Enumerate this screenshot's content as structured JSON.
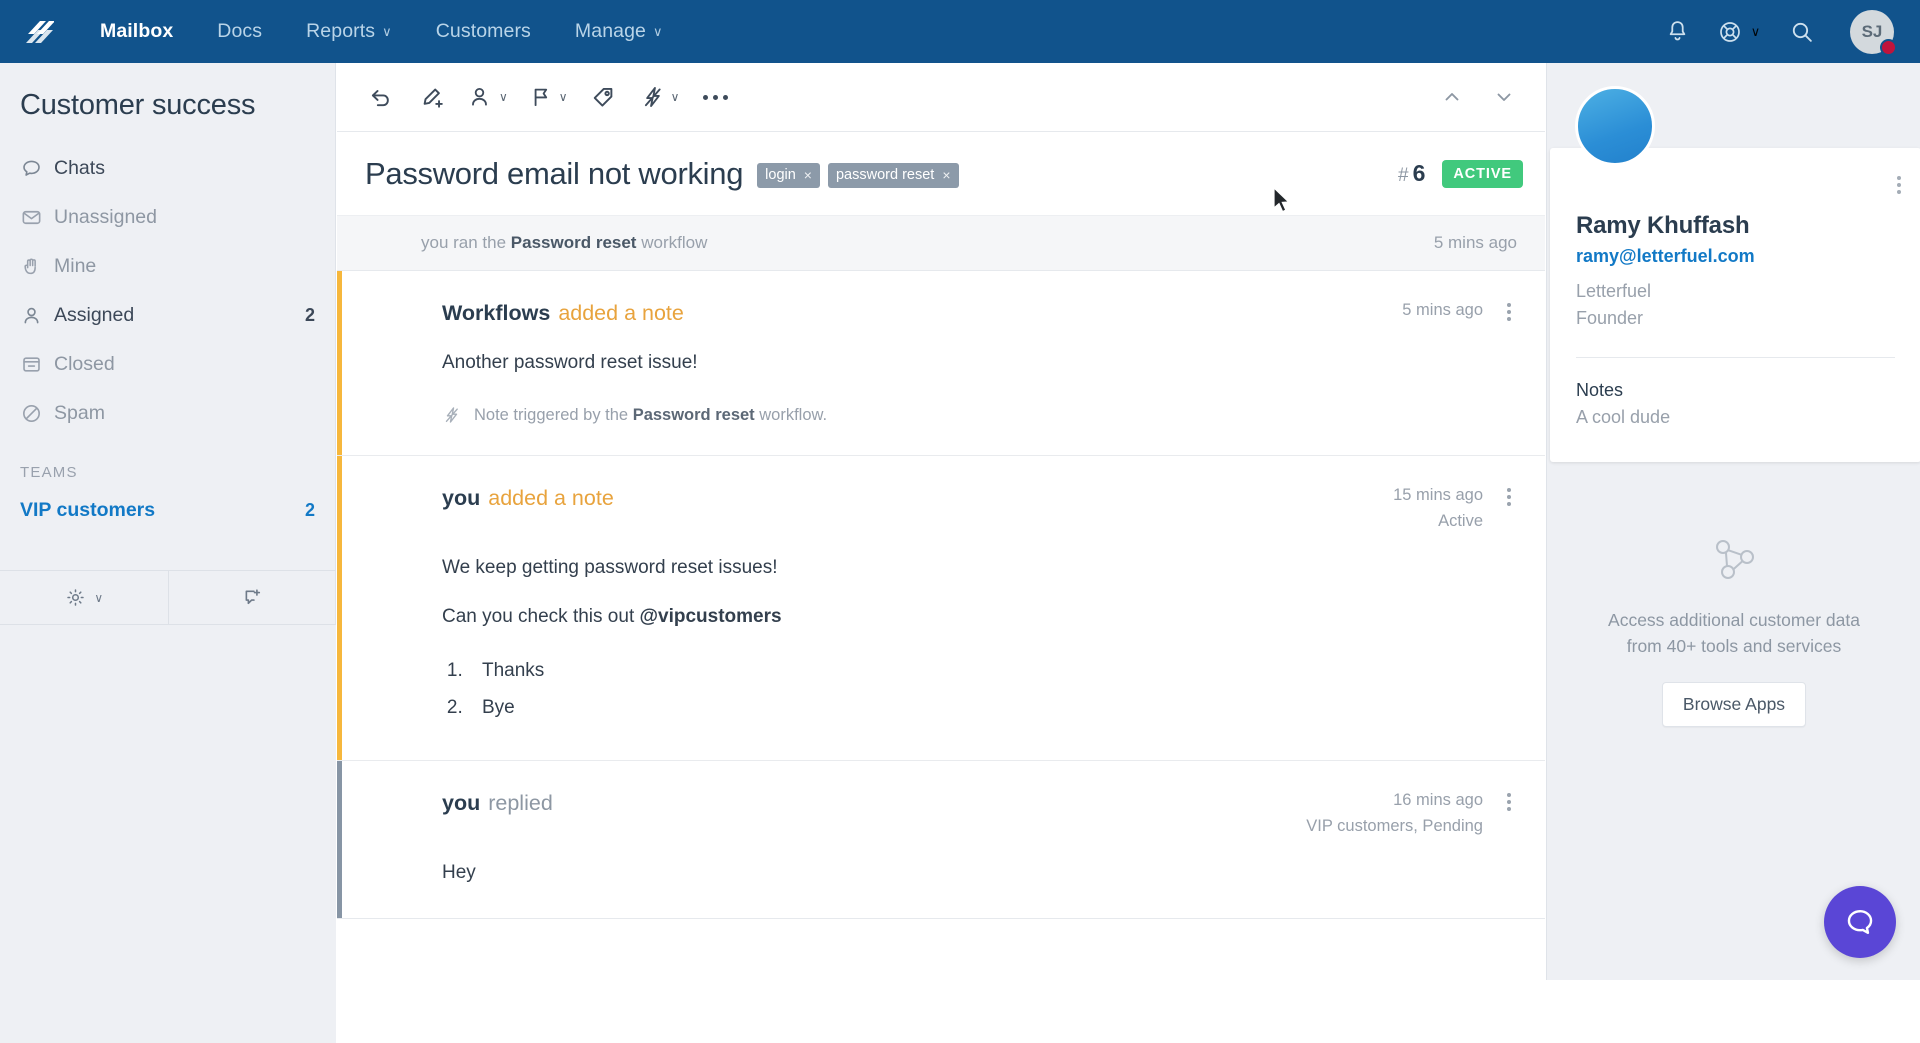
{
  "topnav": {
    "logo_name": "helpscout-logo",
    "links": [
      {
        "label": "Mailbox",
        "active": true,
        "caret": false
      },
      {
        "label": "Docs",
        "active": false,
        "caret": false
      },
      {
        "label": "Reports",
        "active": false,
        "caret": true
      },
      {
        "label": "Customers",
        "active": false,
        "caret": false
      },
      {
        "label": "Manage",
        "active": false,
        "caret": true
      }
    ],
    "icons": [
      "bell-icon",
      "lifebuoy-icon",
      "search-icon"
    ],
    "avatar_initials": "SJ",
    "caret_glyph": "∨"
  },
  "sidebar": {
    "title": "Customer success",
    "items": [
      {
        "label": "Chats",
        "count": "",
        "icon": "chat-bubble-icon",
        "emphasis": true
      },
      {
        "label": "Unassigned",
        "count": "",
        "icon": "envelope-icon",
        "emphasis": false
      },
      {
        "label": "Mine",
        "count": "",
        "icon": "hand-icon",
        "emphasis": false
      },
      {
        "label": "Assigned",
        "count": "2",
        "icon": "person-icon",
        "emphasis": true
      },
      {
        "label": "Closed",
        "count": "",
        "icon": "archive-icon",
        "emphasis": false
      },
      {
        "label": "Spam",
        "count": "",
        "icon": "no-entry-icon",
        "emphasis": false
      }
    ],
    "section_label": "TEAMS",
    "teams": [
      {
        "label": "VIP customers",
        "count": "2"
      }
    ],
    "toolbar": {
      "settings_icon": "gear-icon",
      "settings_caret": "∨",
      "new_conversation_icon": "new-conversation-icon"
    }
  },
  "toolbar": {
    "buttons": [
      {
        "name": "reply-button",
        "icon": "reply-arrow-icon",
        "caret": false
      },
      {
        "name": "add-note-button",
        "icon": "pencil-plus-icon",
        "caret": false
      },
      {
        "name": "assign-button",
        "icon": "person-assign-icon",
        "caret": true
      },
      {
        "name": "status-button",
        "icon": "flag-icon",
        "caret": true
      },
      {
        "name": "tag-button",
        "icon": "tag-icon",
        "caret": false
      },
      {
        "name": "workflow-button",
        "icon": "lightning-bolt-icon",
        "caret": true
      },
      {
        "name": "more-button",
        "icon": "ellipsis-icon",
        "caret": false
      }
    ],
    "prev_icon": "chevron-up-icon",
    "next_icon": "chevron-down-icon",
    "caret_glyph": "∨"
  },
  "conversation": {
    "title": "Password email not working",
    "tags": [
      {
        "label": "login",
        "close": "×"
      },
      {
        "label": "password reset",
        "close": "×"
      }
    ],
    "hash": "#",
    "number": "6",
    "status_badge": "ACTIVE",
    "workflow_bar": {
      "prefix": "you ran the",
      "name": "Password reset",
      "suffix": "workflow",
      "time": "5 mins ago"
    },
    "blocks": [
      {
        "type": "note",
        "actor": "Workflows",
        "action": "added a note",
        "time": "5 mins ago",
        "sub": "",
        "paragraphs": [
          "Another password reset issue!"
        ],
        "list": [],
        "trigger": {
          "icon": "lightning-bolt-icon",
          "prefix": "Note triggered by the",
          "name": "Password reset",
          "suffix": "workflow."
        }
      },
      {
        "type": "note",
        "actor": "you",
        "action": "added a note",
        "time": "15 mins ago",
        "sub": "Active",
        "paragraphs": [
          "We keep getting password reset issues!",
          "Can you check this out @vipcustomers"
        ],
        "mention": "@vipcustomers",
        "list": [
          "Thanks",
          "Bye"
        ],
        "trigger": null
      },
      {
        "type": "reply",
        "actor": "you",
        "action": "replied",
        "time": "16 mins ago",
        "sub": "VIP customers, Pending",
        "paragraphs": [
          "Hey"
        ],
        "list": [],
        "trigger": null
      }
    ]
  },
  "customer": {
    "avatar_name": "customer-avatar",
    "name": "Ramy Khuffash",
    "email": "ramy@letterfuel.com",
    "company": "Letterfuel",
    "role": "Founder",
    "notes_label": "Notes",
    "notes_value": "A cool dude"
  },
  "apps": {
    "icon": "network-nodes-icon",
    "text_line1": "Access additional customer data",
    "text_line2": "from 40+ tools and services",
    "button_label": "Browse Apps"
  },
  "beacon": {
    "icon": "chat-bubble-icon",
    "color": "#5a46d6"
  },
  "colors": {
    "nav_bg": "#11538c",
    "accent_link": "#1279c6",
    "note_border": "#f6b73c",
    "reply_border": "#8795a5",
    "status_active": "#41c97d",
    "panel_bg": "#eef0f4"
  }
}
